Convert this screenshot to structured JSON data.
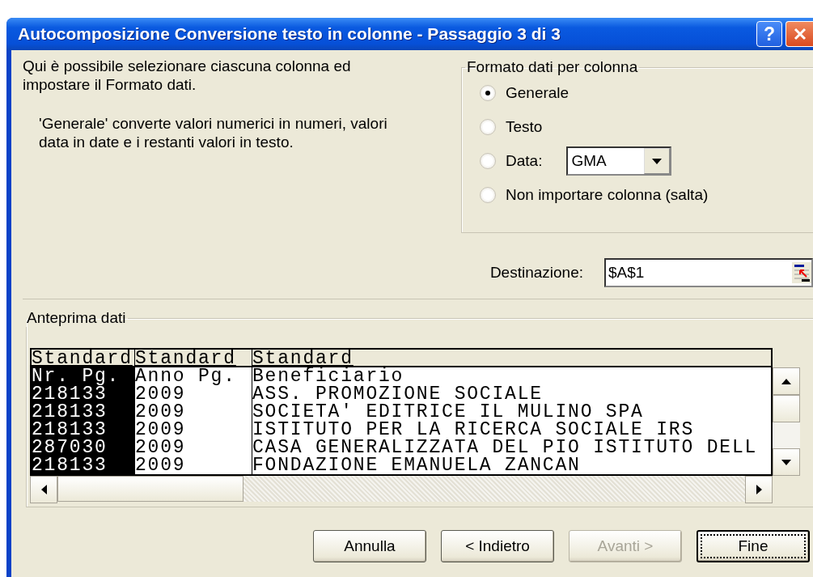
{
  "window": {
    "title": "Autocomposizione Conversione testo in colonne - Passaggio 3 di 3",
    "help_button": "?"
  },
  "description": "Qui è possibile selezionare ciascuna colonna ed impostare il Formato dati.",
  "hint": "'Generale' converte valori numerici in numeri, valori data in date e i restanti valori in testo.",
  "format_group": {
    "legend": "Formato dati per colonna",
    "options": [
      {
        "label": "Generale",
        "selected": true
      },
      {
        "label": "Testo",
        "selected": false
      },
      {
        "label": "Data:",
        "selected": false,
        "kind": "date",
        "date_format": "GMA"
      },
      {
        "label": "Non importare colonna (salta)",
        "selected": false
      }
    ]
  },
  "destination": {
    "label": "Destinazione:",
    "value": "$A$1"
  },
  "preview": {
    "legend": "Anteprima dati",
    "columns": [
      {
        "header": "Standard",
        "selected": true
      },
      {
        "header": "Standard",
        "selected": false
      },
      {
        "header": "Standard",
        "selected": false
      }
    ],
    "rows": [
      [
        "Nr. Pg.",
        "Anno Pg.",
        "Beneficiario"
      ],
      [
        "218133",
        "2009",
        "ASS. PROMOZIONE SOCIALE"
      ],
      [
        "218133",
        "2009",
        "SOCIETA' EDITRICE IL MULINO SPA"
      ],
      [
        "218133",
        "2009",
        "ISTITUTO PER LA RICERCA SOCIALE IRS"
      ],
      [
        "287030",
        "2009",
        "CASA GENERALIZZATA DEL PIO ISTITUTO DELL"
      ],
      [
        "218133",
        "2009",
        "FONDAZIONE EMANUELA ZANCAN"
      ]
    ]
  },
  "buttons": [
    {
      "label": "Annulla",
      "disabled": false,
      "default": false
    },
    {
      "label": "< Indietro",
      "disabled": false,
      "default": false
    },
    {
      "label": "Avanti >",
      "disabled": true,
      "default": false
    },
    {
      "label": "Fine",
      "disabled": false,
      "default": true
    }
  ]
}
